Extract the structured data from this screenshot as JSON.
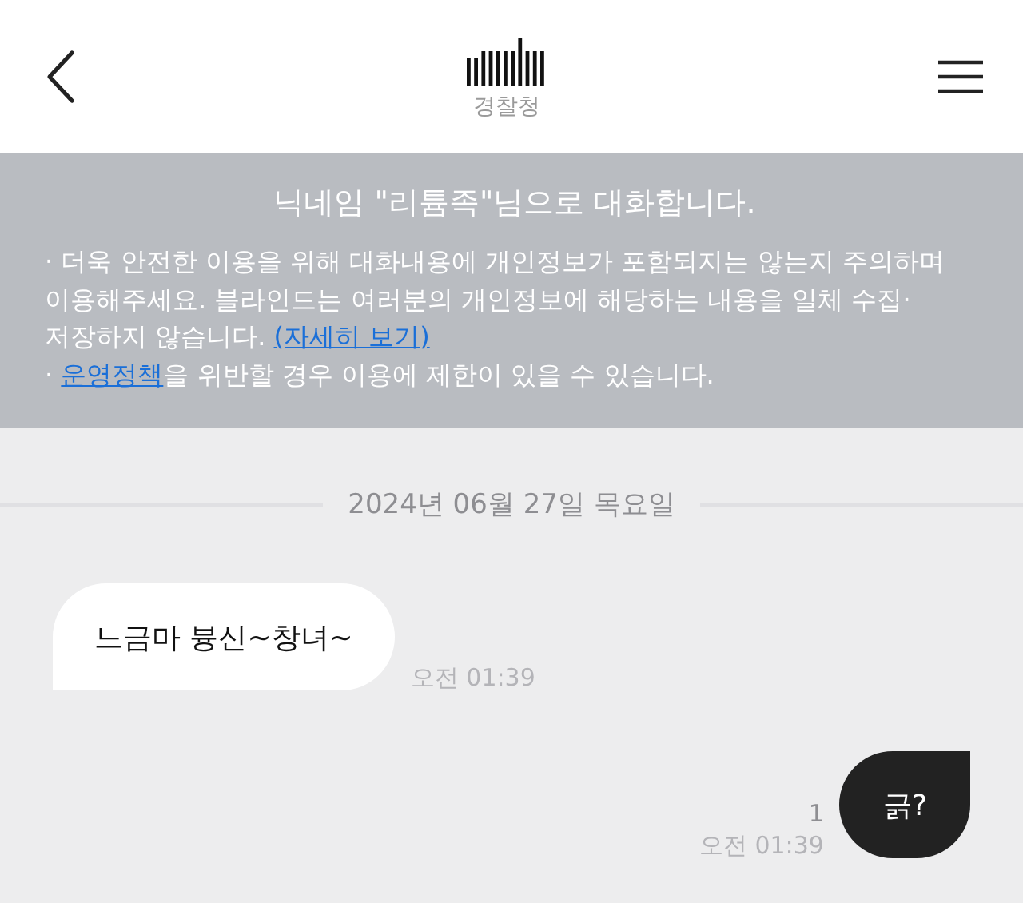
{
  "header": {
    "subtitle": "경찰청"
  },
  "notice": {
    "title": "닉네임 \"리튬족\"님으로 대화합니다.",
    "items": [
      {
        "parts": [
          {
            "kind": "text",
            "text": "· 더욱 안전한 이용을 위해 대화내용에 개인정보가 포함되지는 않는지 주의하며 이용해주세요. 블라인드는 여러분의 개인정보에 해당하는 내용을 일체 수집·저장하지 않습니다. "
          },
          {
            "kind": "link",
            "text": "(자세히 보기)"
          }
        ]
      },
      {
        "parts": [
          {
            "kind": "text",
            "text": "· "
          },
          {
            "kind": "link",
            "text": "운영정책"
          },
          {
            "kind": "text",
            "text": "을 위반할 경우 이용에 제한이 있을 수 있습니다."
          }
        ]
      }
    ]
  },
  "date_separator": "2024년 06월 27일 목요일",
  "messages": [
    {
      "kind": "received",
      "text": "느금마 븅신~창녀~",
      "time": "오전 01:39"
    },
    {
      "kind": "sent",
      "text": "긁?",
      "time": "오전 01:39",
      "unread": "1"
    }
  ]
}
